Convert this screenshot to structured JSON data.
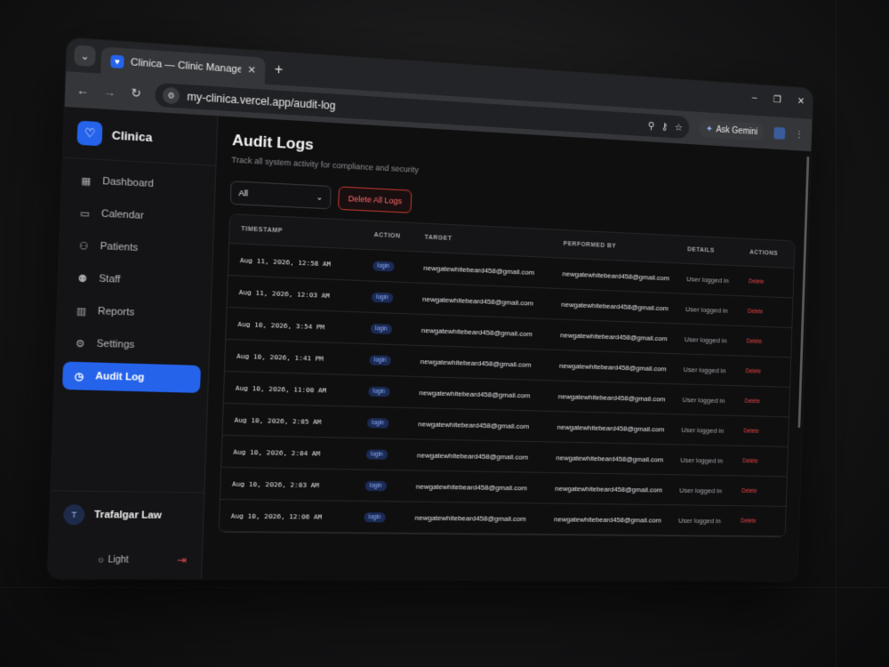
{
  "browser": {
    "tab_title": "Clinica — Clinic Management S",
    "url": "my-clinica.vercel.app/audit-log",
    "ask_gemini": "Ask Gemini"
  },
  "app": {
    "brand": "Clinica",
    "accent_color": "#2563eb",
    "nav": [
      {
        "label": "Dashboard",
        "icon": "grid-icon"
      },
      {
        "label": "Calendar",
        "icon": "calendar-icon"
      },
      {
        "label": "Patients",
        "icon": "users-icon"
      },
      {
        "label": "Staff",
        "icon": "staff-icon"
      },
      {
        "label": "Reports",
        "icon": "bar-chart-icon"
      },
      {
        "label": "Settings",
        "icon": "gear-icon"
      },
      {
        "label": "Audit Log",
        "icon": "clock-icon",
        "active": true
      }
    ],
    "user": {
      "initial": "T",
      "name": "Trafalgar Law"
    },
    "theme_label": "Light"
  },
  "page": {
    "title": "Audit Logs",
    "subtitle": "Track all system activity for compliance and security",
    "filter_value": "All",
    "delete_all_label": "Delete All Logs",
    "columns": [
      "TIMESTAMP",
      "ACTION",
      "TARGET",
      "PERFORMED BY",
      "DETAILS",
      "ACTIONS"
    ],
    "rows": [
      {
        "timestamp": "Aug 11, 2026, 12:58 AM",
        "action": "login",
        "target": "newgatewhitebeard458@gmail.com",
        "performed_by": "newgatewhitebeard458@gmail.com",
        "details": "User logged in",
        "delete": "Delete"
      },
      {
        "timestamp": "Aug 11, 2026, 12:03 AM",
        "action": "login",
        "target": "newgatewhitebeard458@gmail.com",
        "performed_by": "newgatewhitebeard458@gmail.com",
        "details": "User logged in",
        "delete": "Delete"
      },
      {
        "timestamp": "Aug 10, 2026, 3:54 PM",
        "action": "login",
        "target": "newgatewhitebeard458@gmail.com",
        "performed_by": "newgatewhitebeard458@gmail.com",
        "details": "User logged in",
        "delete": "Delete"
      },
      {
        "timestamp": "Aug 10, 2026, 1:41 PM",
        "action": "login",
        "target": "newgatewhitebeard458@gmail.com",
        "performed_by": "newgatewhitebeard458@gmail.com",
        "details": "User logged in",
        "delete": "Delete"
      },
      {
        "timestamp": "Aug 10, 2026, 11:00 AM",
        "action": "login",
        "target": "newgatewhitebeard458@gmail.com",
        "performed_by": "newgatewhitebeard458@gmail.com",
        "details": "User logged in",
        "delete": "Delete"
      },
      {
        "timestamp": "Aug 10, 2026, 2:05 AM",
        "action": "login",
        "target": "newgatewhitebeard458@gmail.com",
        "performed_by": "newgatewhitebeard458@gmail.com",
        "details": "User logged in",
        "delete": "Delete"
      },
      {
        "timestamp": "Aug 10, 2026, 2:04 AM",
        "action": "login",
        "target": "newgatewhitebeard458@gmail.com",
        "performed_by": "newgatewhitebeard458@gmail.com",
        "details": "User logged in",
        "delete": "Delete"
      },
      {
        "timestamp": "Aug 10, 2026, 2:03 AM",
        "action": "login",
        "target": "newgatewhitebeard458@gmail.com",
        "performed_by": "newgatewhitebeard458@gmail.com",
        "details": "User logged in",
        "delete": "Delete"
      },
      {
        "timestamp": "Aug 10, 2026, 12:06 AM",
        "action": "login",
        "target": "newgatewhitebeard458@gmail.com",
        "performed_by": "newgatewhitebeard458@gmail.com",
        "details": "User logged in",
        "delete": "Delete"
      }
    ]
  }
}
